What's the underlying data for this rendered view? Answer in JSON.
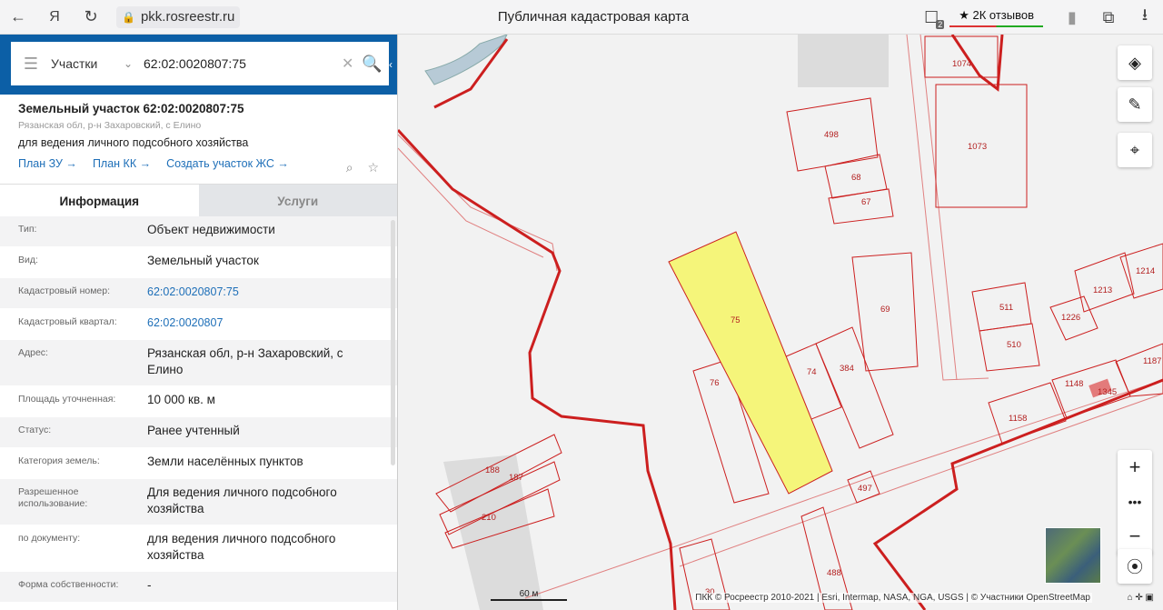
{
  "browser": {
    "url": "pkk.rosreestr.ru",
    "title": "Публичная кадастровая карта",
    "reviews": "★ 2К отзывов",
    "tab_count": "2"
  },
  "search": {
    "type": "Участки",
    "value": "62:02:0020807:75"
  },
  "object": {
    "title": "Земельный участок 62:02:0020807:75",
    "subtitle": "Рязанская обл, р-н Захаровский, с Елино",
    "purpose": "для ведения личного подсобного хозяйства",
    "links": [
      "План ЗУ →",
      "План КК →",
      "Создать участок ЖС →"
    ]
  },
  "tabs": [
    "Информация",
    "Услуги"
  ],
  "properties": [
    {
      "key": "Тип:",
      "value": "Объект недвижимости"
    },
    {
      "key": "Вид:",
      "value": "Земельный участок"
    },
    {
      "key": "Кадастровый номер:",
      "value": "62:02:0020807:75"
    },
    {
      "key": "Кадастровый квартал:",
      "value": "62:02:0020807"
    },
    {
      "key": "Адрес:",
      "value": "Рязанская обл, р-н Захаровский, с Елино"
    },
    {
      "key": "Площадь уточненная:",
      "value": "10 000 кв. м"
    },
    {
      "key": "Статус:",
      "value": "Ранее учтенный"
    },
    {
      "key": "Категория земель:",
      "value": "Земли населённых пунктов"
    },
    {
      "key": "Разрешенное использование:",
      "value": "Для ведения личного подсобного хозяйства"
    },
    {
      "key": "по документу:",
      "value": "для ведения личного подсобного хозяйства"
    },
    {
      "key": "Форма собственности:",
      "value": "-"
    }
  ],
  "map": {
    "parcel_labels": [
      "1074",
      "498",
      "68",
      "67",
      "1073",
      "75",
      "69",
      "511",
      "510",
      "1213",
      "1214",
      "1226",
      "74",
      "384",
      "76",
      "1148",
      "1345",
      "1187",
      "1158",
      "188",
      "187",
      "210",
      "497",
      "488",
      "30"
    ],
    "scale": "60 м",
    "attribution": "ПКК © Росреестр 2010-2021 | Esri, Intermap, NASA, NGA, USGS | © Участники OpenStreetMap",
    "highlight_color": "#f5f57a",
    "boundary_color": "#cc1f1f"
  }
}
